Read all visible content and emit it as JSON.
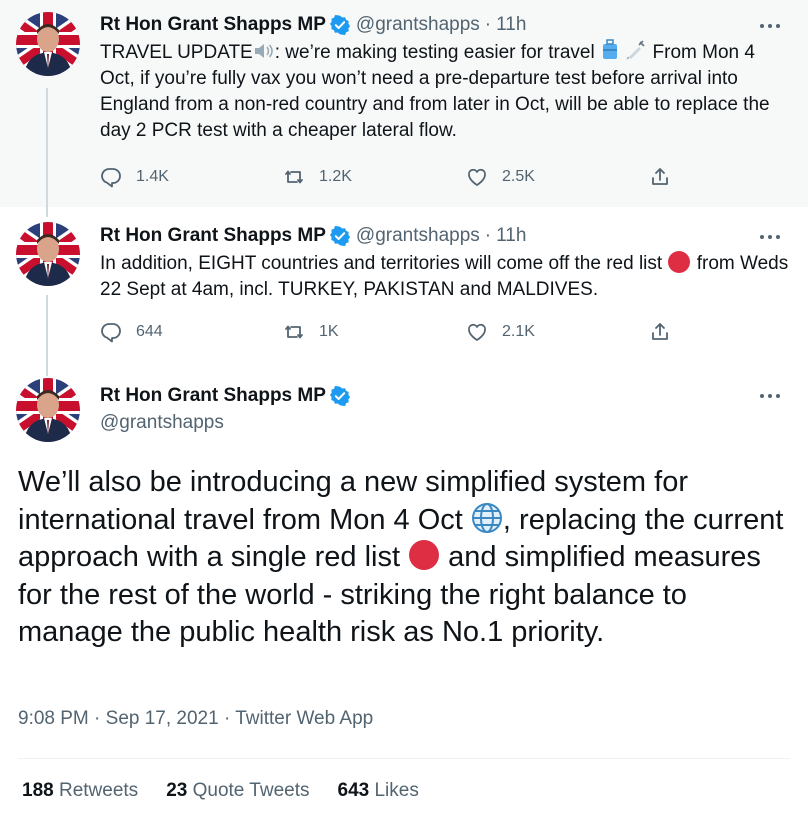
{
  "author": {
    "name": "Rt Hon Grant Shapps MP",
    "handle": "@grantshapps",
    "verified": true
  },
  "thread": [
    {
      "time": "11h",
      "text_before": "TRAVEL UPDATE",
      "text_mid": ": we’re making testing easier for travel ",
      "text_after": " From Mon 4 Oct, if you’re fully vax you won’t need a pre-departure test before arrival into England from a non-red country and from later in Oct, will be able to replace the day 2 PCR test with a cheaper lateral flow.",
      "emojis": [
        "speaker-icon",
        "luggage-icon",
        "syringe-icon"
      ],
      "replies": "1.4K",
      "retweets": "1.2K",
      "likes": "2.5K"
    },
    {
      "time": "11h",
      "text_before": "In addition, EIGHT countries and territories will come off the red list ",
      "text_after": " from Weds 22 Sept at 4am, incl. TURKEY, PAKISTAN and MALDIVES.",
      "emojis": [
        "red-circle-icon"
      ],
      "replies": "644",
      "retweets": "1K",
      "likes": "2.1K"
    }
  ],
  "main_tweet": {
    "text_part1": "We’ll also be introducing a new simplified system for international travel from Mon 4 Oct ",
    "text_part2": ", replacing the current approach with a single red list ",
    "text_part3": " and simplified measures for the rest of the world - striking the right balance to manage the public health risk as No.1 priority.",
    "emojis": [
      "globe-icon",
      "red-circle-icon"
    ],
    "timestamp": "9:08 PM · Sep 17, 2021 · Twitter Web App",
    "retweets_count": "188",
    "retweets_label": "Retweets",
    "quotes_count": "23",
    "quotes_label": "Quote Tweets",
    "likes_count": "643",
    "likes_label": "Likes"
  },
  "colors": {
    "verified_blue": "#1d9bf0",
    "secondary_text": "#536471",
    "highlight_bg": "#f7f9f9",
    "red_circle": "#dd2e44",
    "thread_line": "#cfd9de"
  }
}
